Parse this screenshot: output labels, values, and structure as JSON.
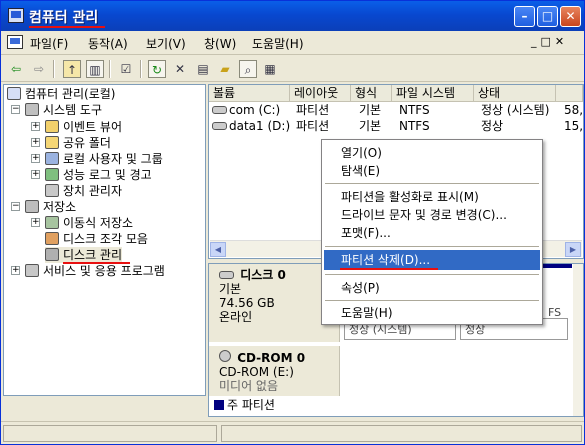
{
  "window": {
    "title": "컴퓨터 관리"
  },
  "menubar": {
    "items": [
      "파일(F)",
      "동작(A)",
      "보기(V)",
      "창(W)",
      "도움말(H)"
    ]
  },
  "toolbar": {
    "icons": [
      "back-arrow-icon",
      "forward-arrow-icon",
      "up-folder-icon",
      "show-hide-tree-icon",
      "properties-icon",
      "refresh-icon",
      "delete-icon",
      "export-icon",
      "open-icon",
      "find-icon",
      "help-icon"
    ]
  },
  "tree": {
    "root": "컴퓨터 관리(로컬)",
    "system_tools": "시스템 도구",
    "event_viewer": "이벤트 뷰어",
    "shared_folders": "공유 폴더",
    "local_users": "로컬 사용자 및 그룹",
    "perf_logs": "성능 로그 및 경고",
    "device_manager": "장치 관리자",
    "storage": "저장소",
    "removable": "이동식 저장소",
    "defrag": "디스크 조각 모음",
    "disk_mgmt": "디스크 관리",
    "services": "서비스 및 응용 프로그램"
  },
  "list": {
    "columns": [
      "볼륨",
      "레이아웃",
      "형식",
      "파일 시스템",
      "상태",
      ""
    ],
    "rows": [
      [
        "com (C:)",
        "파티션",
        "기본",
        "NTFS",
        "정상 (시스템)",
        "58,"
      ],
      [
        "data1 (D:)",
        "파티션",
        "기본",
        "NTFS",
        "정상",
        "15,"
      ]
    ]
  },
  "graph": {
    "disk0_name": "디스크 0",
    "disk0_type": "기본",
    "disk0_size": "74.56 GB",
    "disk0_status": "온라인",
    "partial_text_a": "정상 (시스템)",
    "partial_text_b": "정상",
    "partial_text_c": "FS",
    "cdrom_name": "CD-ROM 0",
    "cdrom_drive": "CD-ROM (E:)",
    "cdrom_status": "미디어 없음",
    "legend": "주 파티션"
  },
  "context_menu": {
    "items": [
      "열기(O)",
      "탐색(E)",
      "파티션을 활성화로 표시(M)",
      "드라이브 문자 및 경로 변경(C)...",
      "포맷(F)...",
      "파티션 삭제(D)...",
      "속성(P)",
      "도움말(H)"
    ],
    "selected": "파티션 삭제(D)..."
  },
  "colors": {
    "accent": "#316ac5",
    "highlight": "#e81010",
    "title": "#0a5fe8"
  }
}
